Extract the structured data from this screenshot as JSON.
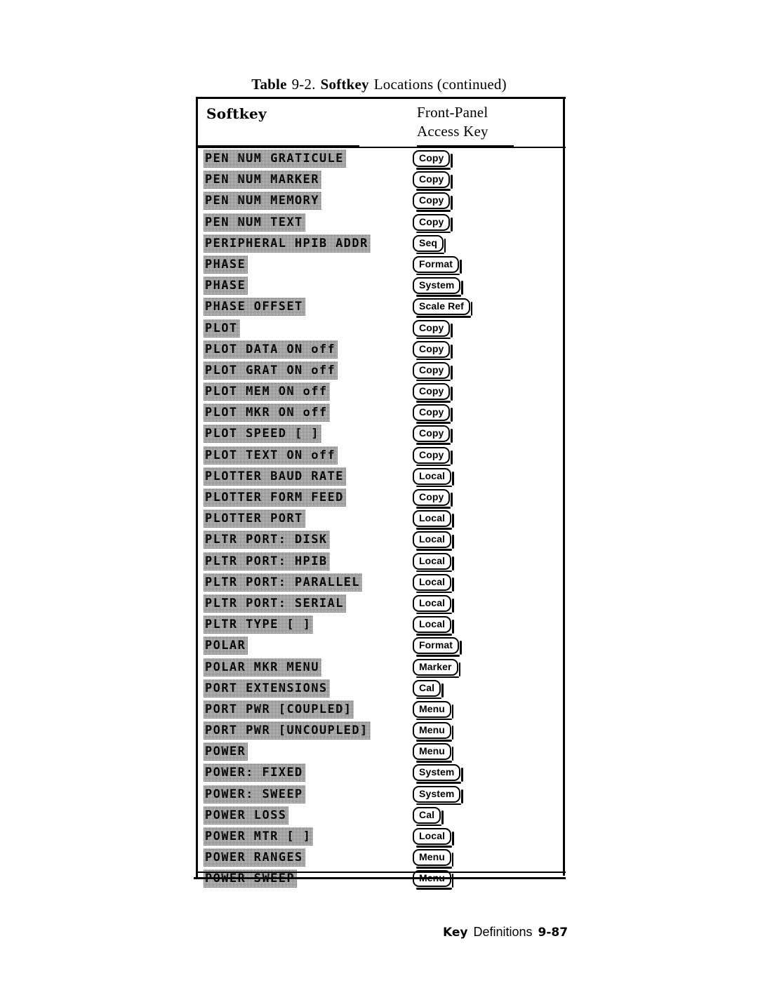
{
  "caption": {
    "table_word": "Table",
    "number": "9-2.",
    "softkey_word": "Softkey",
    "rest": "Locations  (continued)"
  },
  "table": {
    "headers": {
      "softkey": "Softkey",
      "access_key_line1": "Front-Panel",
      "access_key_line2": "Access Key"
    },
    "rows": [
      {
        "softkey": "PEN NUM GRATICULE",
        "access_key": "Copy"
      },
      {
        "softkey": "PEN NUM MARKER",
        "access_key": "Copy"
      },
      {
        "softkey": "PEN NUM MEMORY",
        "access_key": "Copy"
      },
      {
        "softkey": "PEN NUM TEXT",
        "access_key": "Copy"
      },
      {
        "softkey": "PERIPHERAL HPIB ADDR",
        "access_key": "Seq"
      },
      {
        "softkey": "PHASE",
        "access_key": "Format"
      },
      {
        "softkey": "PHASE",
        "access_key": "System"
      },
      {
        "softkey": "PHASE OFFSET",
        "access_key": "Scale Ref"
      },
      {
        "softkey": "PLOT",
        "access_key": "Copy"
      },
      {
        "softkey": "PLOT DATA ON off",
        "access_key": "Copy"
      },
      {
        "softkey": "PLOT GRAT ON off",
        "access_key": "Copy"
      },
      {
        "softkey": "PLOT MEM ON off",
        "access_key": "Copy"
      },
      {
        "softkey": "PLOT MKR ON off",
        "access_key": "Copy"
      },
      {
        "softkey": "PLOT SPEED [ ]",
        "access_key": "Copy"
      },
      {
        "softkey": "PLOT TEXT ON off",
        "access_key": "Copy"
      },
      {
        "softkey": "PLOTTER BAUD RATE",
        "access_key": "Local"
      },
      {
        "softkey": "PLOTTER FORM FEED",
        "access_key": "Copy"
      },
      {
        "softkey": "PLOTTER PORT",
        "access_key": "Local"
      },
      {
        "softkey": "PLTR PORT: DISK",
        "access_key": "Local"
      },
      {
        "softkey": "PLTR PORT: HPIB",
        "access_key": "Local"
      },
      {
        "softkey": "PLTR PORT: PARALLEL",
        "access_key": "Local"
      },
      {
        "softkey": "PLTR PORT: SERIAL",
        "access_key": "Local"
      },
      {
        "softkey": "PLTR TYPE [ ]",
        "access_key": "Local"
      },
      {
        "softkey": "POLAR",
        "access_key": "Format"
      },
      {
        "softkey": "POLAR MKR MENU",
        "access_key": "Marker"
      },
      {
        "softkey": "PORT EXTENSIONS",
        "access_key": "Cal"
      },
      {
        "softkey": "PORT PWR [COUPLED]",
        "access_key": "Menu"
      },
      {
        "softkey": "PORT PWR [UNCOUPLED]",
        "access_key": "Menu"
      },
      {
        "softkey": "POWER",
        "access_key": "Menu"
      },
      {
        "softkey": "POWER: FIXED",
        "access_key": "System"
      },
      {
        "softkey": "POWER: SWEEP",
        "access_key": "System"
      },
      {
        "softkey": "POWER LOSS",
        "access_key": "Cal"
      },
      {
        "softkey": "POWER MTR [ ]",
        "access_key": "Local"
      },
      {
        "softkey": "POWER RANGES",
        "access_key": "Menu"
      },
      {
        "softkey": "POWER SWEEP",
        "access_key": "Menu"
      }
    ]
  },
  "footer": {
    "chapter": "Key",
    "section": "Definitions",
    "page": "9-87"
  }
}
